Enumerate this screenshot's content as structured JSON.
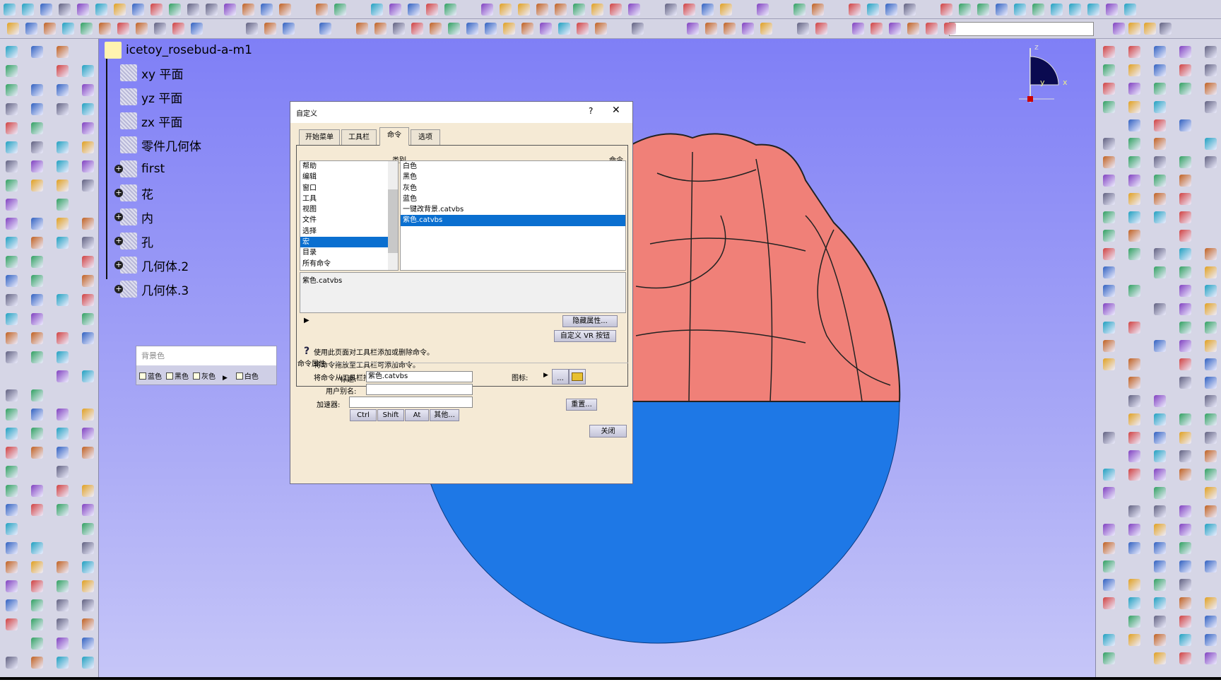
{
  "toolbar": {
    "combo_value": ""
  },
  "tree": {
    "root": "icetoy_rosebud-a-m1",
    "items": [
      {
        "label": "xy 平面",
        "expandable": false
      },
      {
        "label": "yz 平面",
        "expandable": false
      },
      {
        "label": "zx 平面",
        "expandable": false
      },
      {
        "label": "零件几何体",
        "expandable": false
      },
      {
        "label": "first",
        "expandable": true
      },
      {
        "label": "花",
        "expandable": true
      },
      {
        "label": "内",
        "expandable": true
      },
      {
        "label": "孔",
        "expandable": true
      },
      {
        "label": "几何体.2",
        "expandable": true
      },
      {
        "label": "几何体.3",
        "expandable": true
      }
    ]
  },
  "float_toolbar": {
    "title": "背景色",
    "items": [
      "蓝色",
      "黑色",
      "灰色",
      "白色"
    ]
  },
  "compass": {
    "x": "x",
    "y": "y",
    "z": "z"
  },
  "colors": {
    "viewport_top": "#7f7ff6",
    "rose": "#f08078",
    "base": "#1e78e6",
    "selection": "#0a6fd0"
  },
  "dialog": {
    "title": "自定义",
    "help": "?",
    "close": "✕",
    "tabs": [
      "开始菜单",
      "工具栏",
      "命令",
      "选项"
    ],
    "active_tab": "命令",
    "category_header": "类别",
    "command_header": "命令",
    "categories": [
      "帮助",
      "编辑",
      "窗口",
      "工具",
      "视图",
      "文件",
      "选择",
      "宏",
      "目录",
      "所有命令"
    ],
    "selected_category": "宏",
    "commands": [
      "白色",
      "黑色",
      "灰色",
      "蓝色",
      "一键改背景.catvbs",
      "紫色.catvbs"
    ],
    "selected_command": "紫色.catvbs",
    "description": "紫色.catvbs",
    "hide_props": "隐藏属性...",
    "custom_vr": "自定义 VR 按钮",
    "help_lines": [
      "使用此页面对工具栏添加或删除命令。",
      "将命令拖放至工具栏可添加命令。",
      "将命令从工具栏拖放到命令列表可删除命令。"
    ],
    "props": {
      "group": "命令属性",
      "title_label": "标题:",
      "title_value": "紫色.catvbs",
      "alias_label": "用户别名:",
      "alias_value": "",
      "accel_label": "加速器:",
      "accel_value": "",
      "mods": [
        "Ctrl",
        "Shift",
        "At",
        "其他..."
      ],
      "icon_label": "图标:",
      "icon_browse": "...",
      "reset": "重置..."
    },
    "close_button": "关闭"
  }
}
